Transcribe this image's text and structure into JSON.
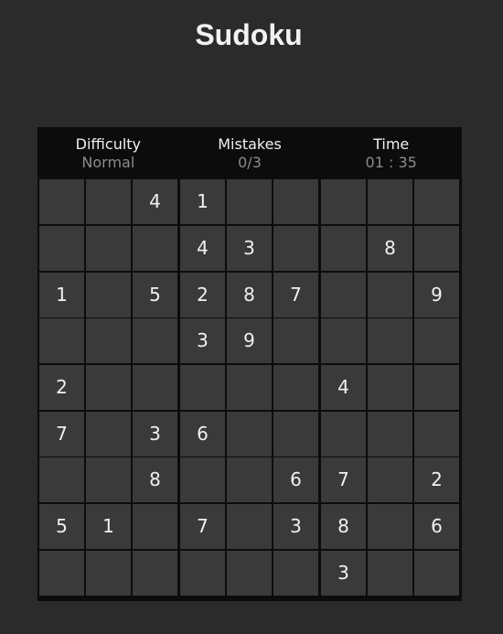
{
  "title": "Sudoku",
  "stats": {
    "difficulty_label": "Difficulty",
    "difficulty_value": "Normal",
    "mistakes_label": "Mistakes",
    "mistakes_value": "0/3",
    "time_label": "Time",
    "time_value": "01 : 35"
  },
  "grid": [
    [
      "",
      "",
      "4",
      "1",
      "",
      "",
      "",
      "",
      ""
    ],
    [
      "",
      "",
      "",
      "4",
      "3",
      "",
      "",
      "8",
      ""
    ],
    [
      "1",
      "",
      "5",
      "2",
      "8",
      "7",
      "",
      "",
      "9"
    ],
    [
      "",
      "",
      "",
      "3",
      "9",
      "",
      "",
      "",
      ""
    ],
    [
      "2",
      "",
      "",
      "",
      "",
      "",
      "4",
      "",
      ""
    ],
    [
      "7",
      "",
      "3",
      "6",
      "",
      "",
      "",
      "",
      ""
    ],
    [
      "",
      "",
      "8",
      "",
      "",
      "6",
      "7",
      "",
      "2"
    ],
    [
      "5",
      "1",
      "",
      "7",
      "",
      "3",
      "8",
      "",
      "6"
    ],
    [
      "",
      "",
      "",
      "",
      "",
      "",
      "3",
      "",
      ""
    ]
  ]
}
